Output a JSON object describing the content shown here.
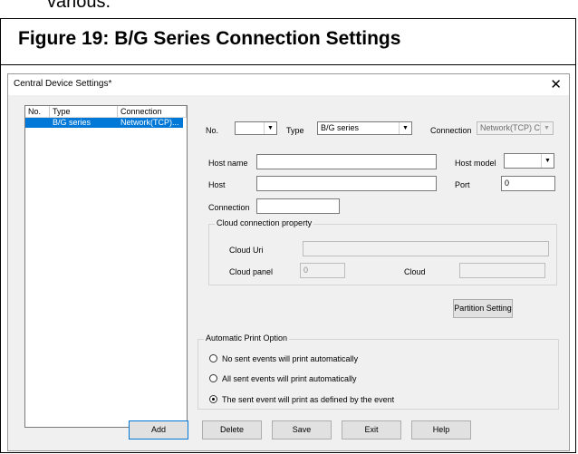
{
  "top_fragment": "various.",
  "figure_title": "Figure 19:  B/G Series Connection Settings",
  "window": {
    "title": "Central Device Settings*",
    "close_glyph": "✕"
  },
  "device_list": {
    "columns": [
      "No.",
      "Type",
      "Connection"
    ],
    "rows": [
      {
        "no": "",
        "type": "B/G series",
        "connection": "Network(TCP)..."
      }
    ]
  },
  "form": {
    "no_label": "No.",
    "no_value": "",
    "type_label": "Type",
    "type_value": "B/G series",
    "connection_label": "Connection",
    "connection_value": "Network(TCP) Cc",
    "host_name_label": "Host name",
    "host_name_value": "",
    "host_model_label": "Host model",
    "host_model_value": "",
    "host_label": "Host",
    "host_value": "",
    "port_label": "Port",
    "port_value": "0",
    "connection2_label": "Connection",
    "connection2_value": ""
  },
  "cloud": {
    "title": "Cloud connection property",
    "uri_label": "Cloud Uri",
    "uri_value": "",
    "panel_label": "Cloud panel",
    "panel_value": "0",
    "cloud_label": "Cloud",
    "cloud_value": ""
  },
  "partition_button": "Partition Setting",
  "print_option": {
    "title": "Automatic Print Option",
    "options": [
      {
        "label": "No sent events will print automatically",
        "checked": false
      },
      {
        "label": "All sent events will print automatically",
        "checked": false
      },
      {
        "label": "The sent event will print as defined by the event",
        "checked": true
      }
    ]
  },
  "buttons": {
    "add": "Add",
    "delete": "Delete",
    "save": "Save",
    "exit": "Exit",
    "help": "Help"
  },
  "colors": {
    "selection": "#0078d7",
    "window_bg": "#f0f0f0"
  }
}
